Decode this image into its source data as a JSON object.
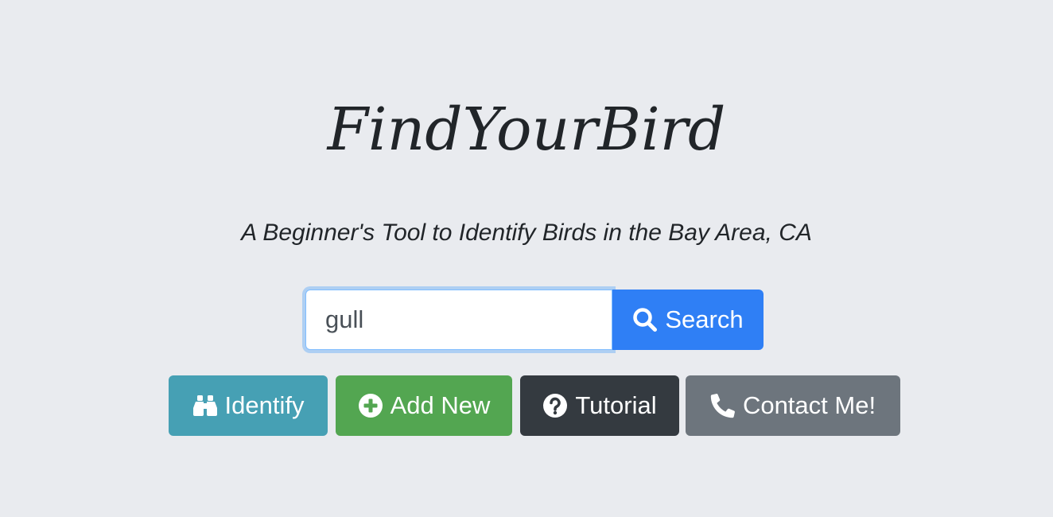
{
  "header": {
    "title": "FindYourBird",
    "subtitle": "A Beginner's Tool to Identify Birds in the Bay Area, CA"
  },
  "search": {
    "value": "gull",
    "button_label": "Search",
    "button_icon": "search-icon"
  },
  "actions": [
    {
      "label": "Identify",
      "icon": "binoculars-icon",
      "color": "#46a0b4"
    },
    {
      "label": "Add New",
      "icon": "plus-circle-icon",
      "color": "#53a651"
    },
    {
      "label": "Tutorial",
      "icon": "question-circle-icon",
      "color": "#343a40"
    },
    {
      "label": "Contact Me!",
      "icon": "phone-icon",
      "color": "#6d757d"
    }
  ],
  "colors": {
    "background": "#e9ebef",
    "primary": "#2f7ff5"
  }
}
